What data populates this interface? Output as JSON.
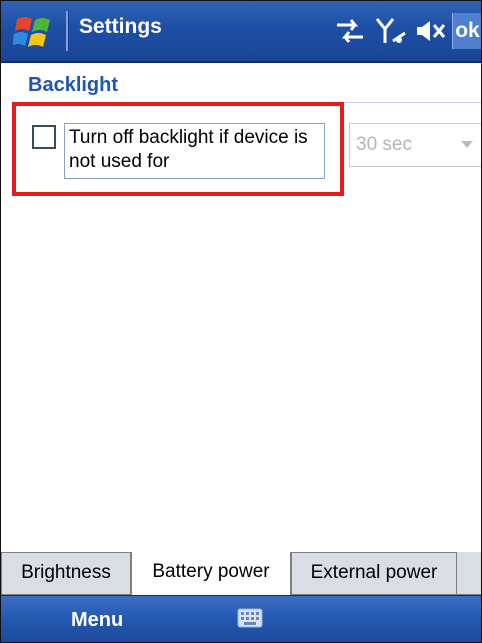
{
  "titlebar": {
    "title": "Settings",
    "ok_label": "ok",
    "icons": [
      "windows-flag-icon",
      "connectivity-icon",
      "signal-icon",
      "speaker-mute-icon"
    ]
  },
  "section": {
    "title": "Backlight"
  },
  "backlight": {
    "checkbox_checked": false,
    "checkbox_label": "Turn off backlight if device is not used for",
    "timeout_value": "30 sec",
    "timeout_enabled": false
  },
  "tabs": [
    {
      "label": "Brightness",
      "active": false
    },
    {
      "label": "Battery power",
      "active": true
    },
    {
      "label": "External power",
      "active": false
    }
  ],
  "menubar": {
    "menu_label": "Menu",
    "input_icon": "keyboard-icon"
  },
  "colors": {
    "titlebar_blue": "#1e4fa6",
    "section_title_blue": "#1f56b3",
    "highlight_red": "#e51c24",
    "disabled_gray": "#b5b5b5"
  }
}
